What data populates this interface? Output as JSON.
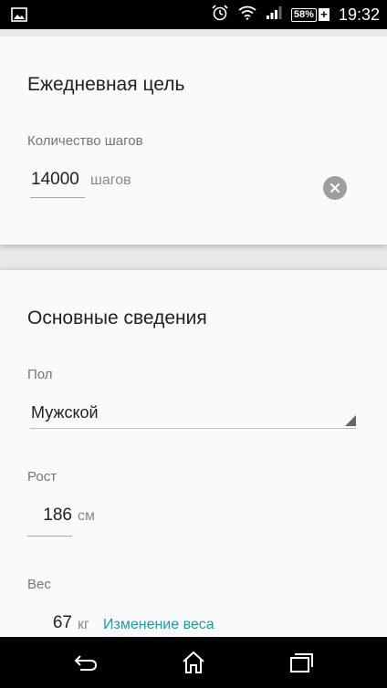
{
  "status_bar": {
    "battery": "58%",
    "battery_charging": "+",
    "time": "19:32"
  },
  "daily_goal": {
    "title": "Ежедневная цель",
    "steps_label": "Количество шагов",
    "steps_value": "14000",
    "steps_unit": "шагов"
  },
  "basic_info": {
    "title": "Основные сведения",
    "gender_label": "Пол",
    "gender_value": "Мужской",
    "height_label": "Рост",
    "height_value": "186",
    "height_unit": "см",
    "weight_label": "Вес",
    "weight_value": "67",
    "weight_unit": "кг",
    "weight_change_link": "Изменение веса"
  },
  "colors": {
    "link": "#1e9aa5",
    "card_bg": "#fafafa",
    "page_bg": "#e9e9e9"
  }
}
